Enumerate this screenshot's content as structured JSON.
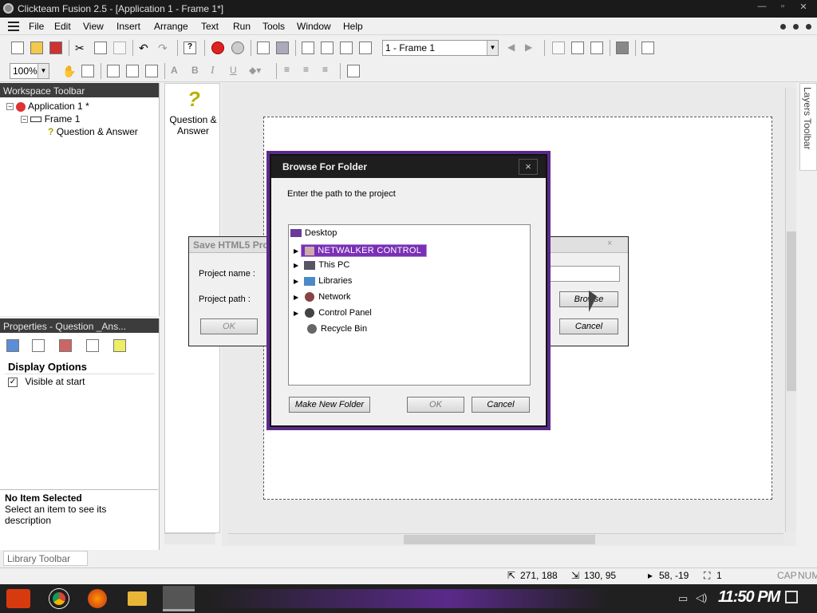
{
  "window": {
    "title": "Clickteam Fusion 2.5 - [Application 1 - Frame 1*]"
  },
  "menu": [
    "File",
    "Edit",
    "View",
    "Insert",
    "Arrange",
    "Text",
    "Run",
    "Tools",
    "Window",
    "Help"
  ],
  "toolbar": {
    "frame_select": "1 - Frame 1",
    "zoom": "100%"
  },
  "workspace": {
    "title": "Workspace Toolbar",
    "tree": [
      {
        "label": "Application 1 *"
      },
      {
        "label": "Frame 1"
      },
      {
        "label": "Question & Answer"
      }
    ]
  },
  "object_panel": {
    "label1": "Question &",
    "label2": "Answer"
  },
  "properties": {
    "title": "Properties - Question _Ans...",
    "section": "Display Options",
    "checkbox_label": "Visible at start",
    "desc_title": "No Item Selected",
    "desc_text": "Select an item to see its description"
  },
  "layers": {
    "title": "Layers Toolbar"
  },
  "library": {
    "title": "Library Toolbar"
  },
  "save_dialog": {
    "title": "Save HTML5 Proj",
    "project_name_label": "Project name :",
    "project_path_label": "Project path :",
    "ok": "OK",
    "browse": "Browse",
    "cancel": "Cancel"
  },
  "browse_dialog": {
    "title": "Browse For Folder",
    "close": "×",
    "instruction": "Enter the path to the project",
    "items": [
      {
        "label": "Desktop",
        "expandable": false,
        "selected": false
      },
      {
        "label": "NETWALKER CONTROL",
        "expandable": true,
        "selected": true
      },
      {
        "label": "This PC",
        "expandable": true,
        "selected": false
      },
      {
        "label": "Libraries",
        "expandable": true,
        "selected": false
      },
      {
        "label": "Network",
        "expandable": true,
        "selected": false
      },
      {
        "label": "Control Panel",
        "expandable": true,
        "selected": false
      },
      {
        "label": "Recycle Bin",
        "expandable": false,
        "selected": false
      }
    ],
    "make_folder": "Make New Folder",
    "ok": "OK",
    "cancel": "Cancel"
  },
  "statusbar": {
    "coords1": "271, 188",
    "coords2": "130, 95",
    "coords3": "58, -19",
    "count": "1",
    "caps": "CAP",
    "num": "NUM"
  },
  "taskbar": {
    "clock": "11:50 PM"
  },
  "colors": {
    "selection": "#7a2fb5",
    "titlebar": "#1a1a1a",
    "dialog_header": "#1e1e1e"
  }
}
